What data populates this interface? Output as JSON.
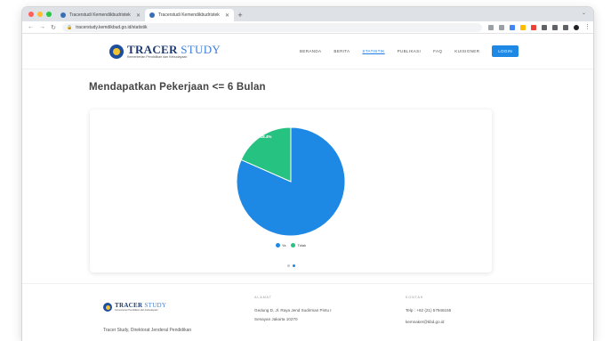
{
  "browser": {
    "tabs": [
      {
        "title": "Tracerstudi Kemendikbudristek",
        "active": false
      },
      {
        "title": "Tracerstudi Kemendikbudristek",
        "active": true
      }
    ],
    "url": "tracerstudy.kemdikbud.go.id/statistik"
  },
  "site": {
    "logo_title_bold": "TRACER",
    "logo_title_thin": "STUDY",
    "logo_subtitle": "Kementerian Pendidikan dan Kebudayaan",
    "menu": [
      {
        "label": "BERANDA",
        "active": false
      },
      {
        "label": "BERITA",
        "active": false
      },
      {
        "label": "STATISTIK",
        "active": true
      },
      {
        "label": "PUBLIKASI",
        "active": false
      },
      {
        "label": "FAQ",
        "active": false
      },
      {
        "label": "KUISIONER",
        "active": false
      }
    ],
    "login_label": "LOGIN"
  },
  "main": {
    "title": "Mendapatkan Pekerjaan <= 6 Bulan"
  },
  "chart_data": {
    "type": "pie",
    "title": "",
    "categories": [
      "Ya",
      "Tidak"
    ],
    "values": [
      81.6,
      18.4
    ],
    "labels": [
      "81.6%",
      "18.4%"
    ],
    "colors": [
      "#1e88e5",
      "#26c281"
    ],
    "legend_position": "bottom",
    "carousel_pages": 2,
    "carousel_active": 2
  },
  "footer": {
    "logo_title_bold": "TRACER",
    "logo_title_thin": "STUDY",
    "logo_subtitle": "Kementerian Pendidikan dan Kebudayaan",
    "description": "Tracer Study, Direktorat Jenderal Pendidikan",
    "address_heading": "ALAMAT",
    "address_line1": "Gedung D, Jl. Raya Jend Sudirman Pintu I",
    "address_line2": "Senayan Jakarta 10270",
    "contact_heading": "KONTAK",
    "phone": "Telp : +62 (21) 57946155",
    "email": "kemnaker@kbd.go.id"
  }
}
